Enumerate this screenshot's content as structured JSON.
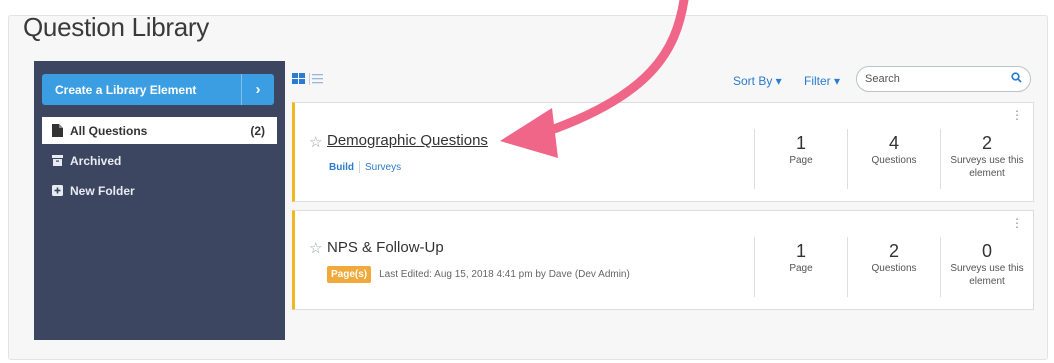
{
  "page": {
    "title": "Question Library"
  },
  "sidebar": {
    "create_button": "Create a Library Element",
    "create_arrow": "›",
    "items": [
      {
        "label": "All Questions",
        "count": "(2)",
        "icon": "file-icon"
      },
      {
        "label": "Archived",
        "count": "",
        "icon": "archive-icon"
      },
      {
        "label": "New Folder",
        "count": "",
        "icon": "plus-square-icon"
      }
    ]
  },
  "toolbar": {
    "sort_label": "Sort By ▾",
    "filter_label": "Filter ▾",
    "search_placeholder": "Search",
    "view_modes": [
      "grid-view-icon",
      "list-view-icon"
    ]
  },
  "cards": [
    {
      "title": "Demographic Questions",
      "links": [
        "Build",
        "Surveys"
      ],
      "stats": [
        {
          "num": "1",
          "label": "Page"
        },
        {
          "num": "4",
          "label": "Questions"
        },
        {
          "num": "2",
          "label": "Surveys use this element"
        }
      ]
    },
    {
      "title": "NPS & Follow-Up",
      "badge": "Page(s)",
      "meta": "Last Edited: Aug 15, 2018 4:41 pm by Dave (Dev Admin)",
      "stats": [
        {
          "num": "1",
          "label": "Page"
        },
        {
          "num": "2",
          "label": "Questions"
        },
        {
          "num": "0",
          "label": "Surveys use this element"
        }
      ]
    }
  ],
  "colors": {
    "sidebar_bg": "#3c4660",
    "accent_blue": "#3c9ee2",
    "card_border_accent": "#f2b622",
    "annotation_arrow": "#f06688"
  }
}
